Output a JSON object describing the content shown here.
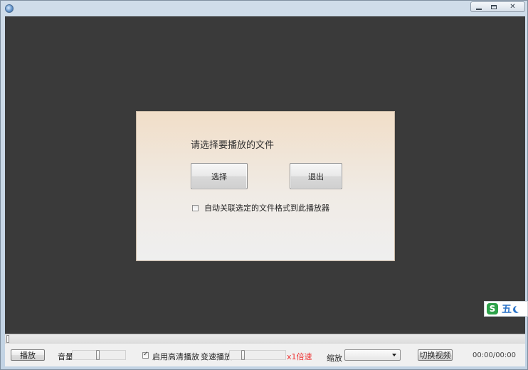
{
  "window": {
    "title": "",
    "controls": {
      "minimize": "minimize",
      "maximize": "maximize",
      "close": "close"
    }
  },
  "dialog": {
    "prompt": "请选择要播放的文件",
    "select_label": "选择",
    "exit_label": "退出",
    "associate_label": "自动关联选定的文件格式到此播放器",
    "associate_checked": false
  },
  "toolbar": {
    "play_label": "播放",
    "volume_label": "音量",
    "volume_level": 0.48,
    "hd_label": "启用高清播放",
    "hd_checked": true,
    "speed_label": "变速播放",
    "speed_value_label": "x1倍速",
    "speed_level": 0.22,
    "zoom_label": "缩放",
    "zoom_value": "",
    "switch_label": "切换视频",
    "time": "00:00/00:00"
  },
  "seek": {
    "position": 0.0
  },
  "ime": {
    "logo": "S",
    "char": "五"
  },
  "colors": {
    "video_bg": "#3a3a3a",
    "dialog_top": "#f1dec8",
    "speed_text": "#e33333",
    "ime_green": "#2da24a",
    "ime_blue": "#2a73c9"
  }
}
